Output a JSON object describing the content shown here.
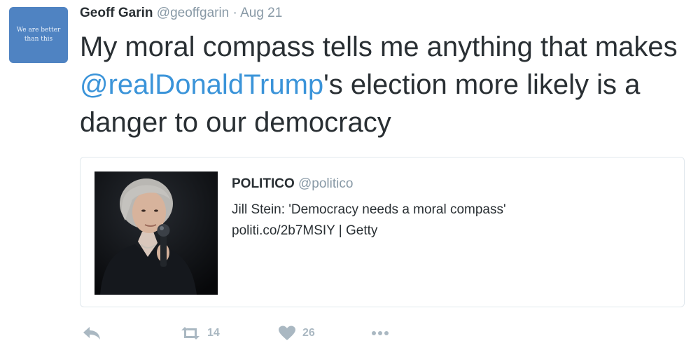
{
  "avatar": {
    "text_line1": "We are better",
    "text_line2": "than this"
  },
  "author": {
    "name": "Geoff Garin",
    "handle": "@geoffgarin",
    "separator": "·",
    "date": "Aug 21"
  },
  "tweet": {
    "text_before": "My moral compass tells me anything that makes ",
    "mention": "@realDonaldTrump",
    "text_after": "'s election more likely is a danger to our democracy"
  },
  "quote": {
    "name": "POLITICO",
    "handle": "@politico",
    "text_line1": "Jill Stein: 'Democracy needs a moral compass'",
    "text_line2": "politi.co/2b7MSIY | Getty"
  },
  "actions": {
    "reply_icon": "reply-icon",
    "retweet_icon": "retweet-icon",
    "retweet_count": "14",
    "like_icon": "heart-icon",
    "like_count": "26",
    "more_icon": "more-icon"
  },
  "colors": {
    "link": "#3b94d9",
    "muted": "#8899a6",
    "action": "#aab8c2",
    "avatar_bg": "#4f83c2"
  }
}
